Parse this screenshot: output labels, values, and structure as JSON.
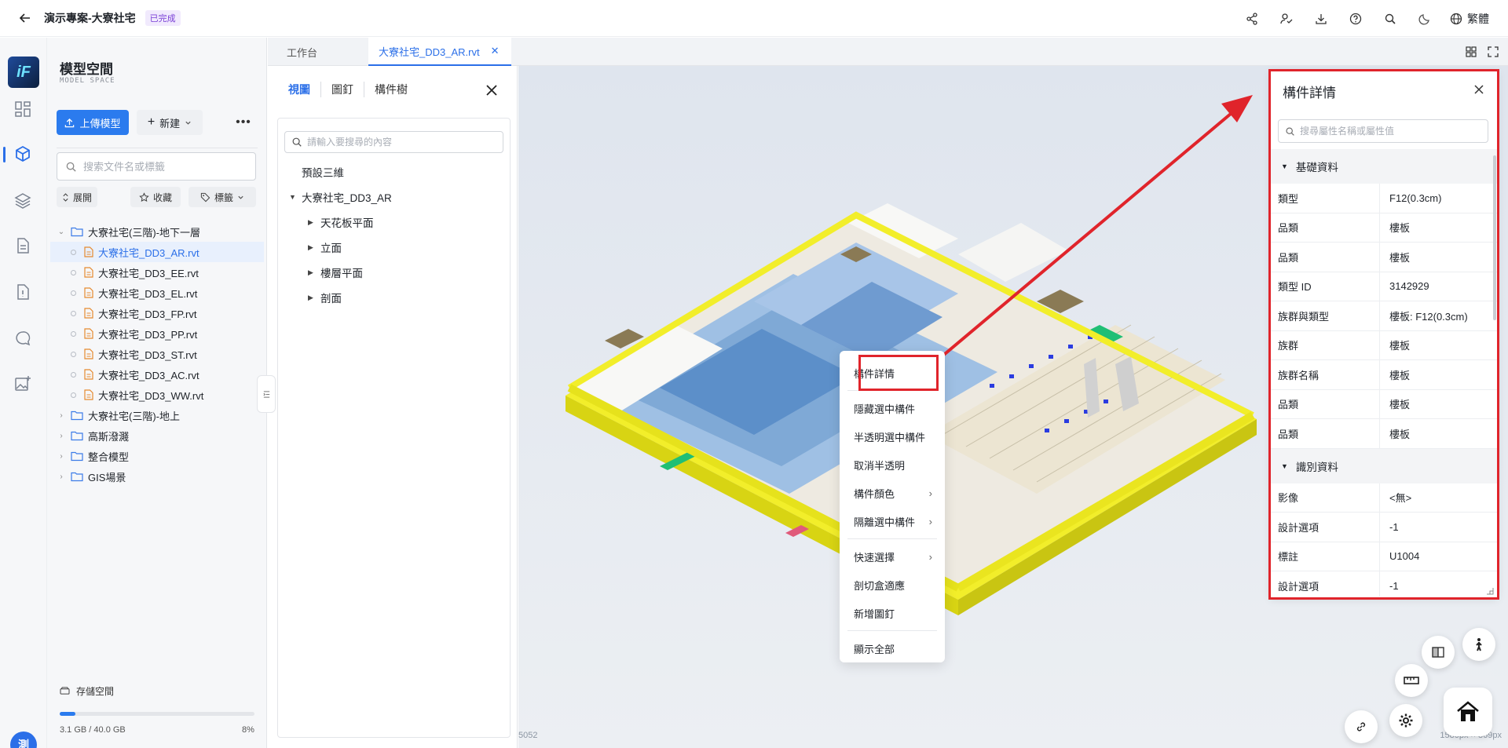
{
  "topbar": {
    "project_title": "演示專案-大寮社宅",
    "status_badge": "已完成",
    "language": "繁體"
  },
  "rail": {
    "avatar_text": "測"
  },
  "left_panel": {
    "title": "模型空間",
    "subtitle": "MODEL SPACE",
    "upload_label": "上傳模型",
    "new_label": "新建",
    "search_placeholder": "搜索文件名或標籤",
    "chips": {
      "expand": "展開",
      "favorite": "收藏",
      "tags": "標籤"
    },
    "tree": [
      {
        "label": "大寮社宅(三階)-地下一層",
        "type": "folder",
        "expanded": true
      },
      {
        "label": "大寮社宅_DD3_AR.rvt",
        "type": "file",
        "selected": true
      },
      {
        "label": "大寮社宅_DD3_EE.rvt",
        "type": "file"
      },
      {
        "label": "大寮社宅_DD3_EL.rvt",
        "type": "file"
      },
      {
        "label": "大寮社宅_DD3_FP.rvt",
        "type": "file"
      },
      {
        "label": "大寮社宅_DD3_PP.rvt",
        "type": "file"
      },
      {
        "label": "大寮社宅_DD3_ST.rvt",
        "type": "file"
      },
      {
        "label": "大寮社宅_DD3_AC.rvt",
        "type": "file"
      },
      {
        "label": "大寮社宅_DD3_WW.rvt",
        "type": "file"
      },
      {
        "label": "大寮社宅(三階)-地上",
        "type": "folder"
      },
      {
        "label": "高斯潑濺",
        "type": "folder"
      },
      {
        "label": "整合模型",
        "type": "folder"
      },
      {
        "label": "GIS場景",
        "type": "folder"
      }
    ],
    "storage": {
      "label": "存儲空間",
      "usage": "3.1 GB / 40.0 GB",
      "percent_text": "8%",
      "fraction": 0.08
    }
  },
  "tabs": [
    {
      "label": "工作台"
    },
    {
      "label": "大寮社宅_DD3_AR.rvt",
      "active": true
    }
  ],
  "view_panel": {
    "tabs": [
      "視圖",
      "圖釘",
      "構件樹"
    ],
    "search_placeholder": "請輸入要搜尋的內容",
    "tree": [
      {
        "label": "預設三維",
        "level": 0,
        "arrow": ""
      },
      {
        "label": "大寮社宅_DD3_AR",
        "level": 0,
        "arrow": "down"
      },
      {
        "label": "天花板平面",
        "level": 1,
        "arrow": "right"
      },
      {
        "label": "立面",
        "level": 1,
        "arrow": "right"
      },
      {
        "label": "樓層平面",
        "level": 1,
        "arrow": "right"
      },
      {
        "label": "剖面",
        "level": 1,
        "arrow": "right"
      }
    ]
  },
  "viewport": {
    "coord_left": "5052",
    "coord_right": "1580px × 869px"
  },
  "context_menu": {
    "items": [
      {
        "label": "構件詳情",
        "submenu": false
      },
      {
        "label": "隱藏選中構件",
        "submenu": false
      },
      {
        "label": "半透明選中構件",
        "submenu": false
      },
      {
        "label": "取消半透明",
        "submenu": false
      },
      {
        "label": "構件顏色",
        "submenu": true
      },
      {
        "label": "隔離選中構件",
        "submenu": true
      },
      {
        "label": "快速選擇",
        "submenu": true
      },
      {
        "label": "剖切盒適應",
        "submenu": false
      },
      {
        "label": "新增圖釘",
        "submenu": false
      },
      {
        "label": "顯示全部",
        "submenu": false
      }
    ]
  },
  "property_panel": {
    "title": "構件詳情",
    "search_placeholder": "搜尋屬性名稱或屬性值",
    "sections": [
      {
        "title": "基礎資料",
        "rows": [
          {
            "key": "類型",
            "value": "F12(0.3cm)"
          },
          {
            "key": "品類",
            "value": "樓板"
          },
          {
            "key": "品類",
            "value": "樓板"
          },
          {
            "key": "類型 ID",
            "value": "3142929"
          },
          {
            "key": "族群與類型",
            "value": "樓板: F12(0.3cm)"
          },
          {
            "key": "族群",
            "value": "樓板"
          },
          {
            "key": "族群名稱",
            "value": "樓板"
          },
          {
            "key": "品類",
            "value": "樓板"
          },
          {
            "key": "品類",
            "value": "樓板"
          }
        ]
      },
      {
        "title": "識別資料",
        "rows": [
          {
            "key": "影像",
            "value": "<無>"
          },
          {
            "key": "設計選項",
            "value": "-1"
          },
          {
            "key": "標註",
            "value": "U1004"
          },
          {
            "key": "設計選項",
            "value": "-1"
          }
        ]
      }
    ]
  },
  "colors": {
    "accent": "#2b6fe8",
    "annotation_red": "#e0242b",
    "model_yellow": "#f2ee2a"
  }
}
